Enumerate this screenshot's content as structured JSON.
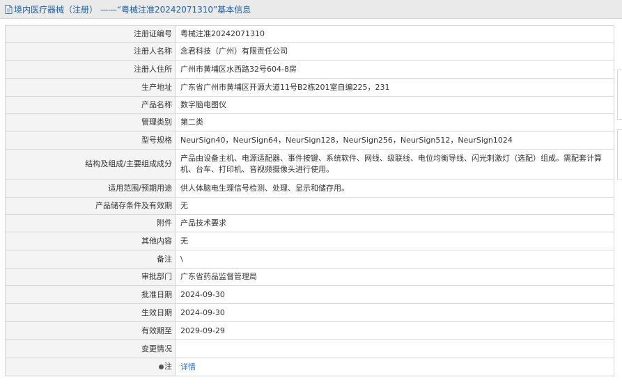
{
  "header": {
    "title": "境内医疗器械（注册） ——“粤械注准20242071310”基本信息",
    "icon": "document-icon"
  },
  "rows": [
    {
      "label": "注册证编号",
      "value": "粤械注准20242071310"
    },
    {
      "label": "注册人名称",
      "value": "念君科技（广州）有限责任公司"
    },
    {
      "label": "注册人住所",
      "value": "广州市黄埔区水西路32号604-8房"
    },
    {
      "label": "生产地址",
      "value": "广东省广州市黄埔区开源大道11号B2栋201室自编225，231"
    },
    {
      "label": "产品名称",
      "value": "数字脑电图仪"
    },
    {
      "label": "管理类别",
      "value": "第二类"
    },
    {
      "label": "型号规格",
      "value": "NeurSign40，NeurSign64，NeurSign128，NeurSign256，NeurSign512，NeurSign1024"
    },
    {
      "label": "结构及组成/主要组成成分",
      "value": "产品由设备主机、电源适配器、事件按键、系统软件、网线、级联线、电位均衡导线、闪光刺激灯（选配）组成。需配套计算机、台车、打印机、音视频摄像头进行使用。"
    },
    {
      "label": "适用范围/预期用途",
      "value": "供人体脑电生理信号检测、处理、显示和储存用。"
    },
    {
      "label": "产品储存条件及有效期",
      "value": "无"
    },
    {
      "label": "附件",
      "value": "产品技术要求"
    },
    {
      "label": "其他内容",
      "value": "无"
    },
    {
      "label": "备注",
      "value": "\\"
    },
    {
      "label": "审批部门",
      "value": "广东省药品监督管理局"
    },
    {
      "label": "批准日期",
      "value": "2024-09-30"
    },
    {
      "label": "生效日期",
      "value": "2024-09-30"
    },
    {
      "label": "有效期至",
      "value": "2029-09-29"
    },
    {
      "label": "变更情况",
      "value": ""
    }
  ],
  "note": {
    "label": "注",
    "link_text": "详情",
    "icon": "dot-icon"
  },
  "colors": {
    "title_text": "#1f5d9e",
    "title_bg": "#eaeaea",
    "label_bg": "#f4f4f4",
    "border": "#d5d5d5",
    "link": "#2a73c0"
  }
}
